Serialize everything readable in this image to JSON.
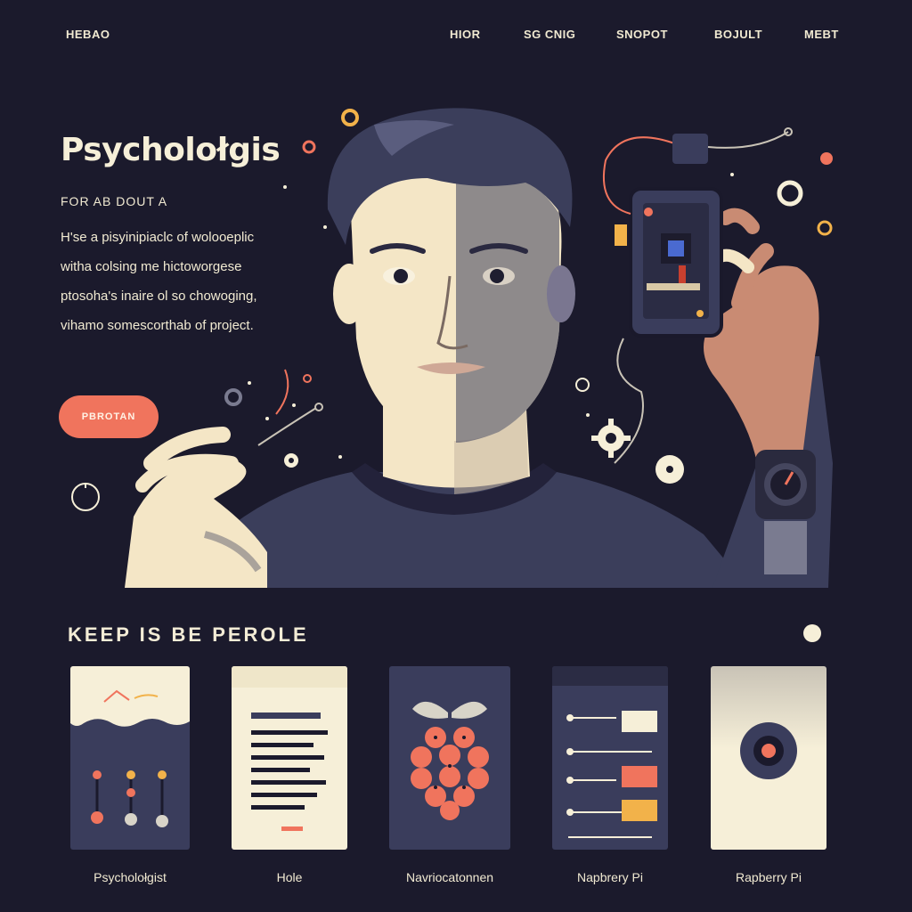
{
  "header": {
    "logo": "HEBAO",
    "nav": [
      "HIOR",
      "SG CNIG",
      "SNOPOT",
      "BOJULT",
      "MEBT"
    ]
  },
  "hero": {
    "title": "Psycholołgis",
    "kicker": "FOR AB DOUT A",
    "description": [
      "H'se a pisyinipiaclc of wolooeplic",
      "witha colsing me hictoworgese",
      "ptosoha's inaire ol so chowoging,",
      "vihamo somescorthab of project."
    ],
    "cta": "PBROTAN"
  },
  "section": {
    "title": "KEEP IS BE PEROLE"
  },
  "cards": [
    {
      "label": "Psycholołgist"
    },
    {
      "label": "Hole"
    },
    {
      "label": "Navriocatonnen"
    },
    {
      "label": "Napbrery Pi"
    },
    {
      "label": "Rapberry Pi"
    }
  ],
  "colors": {
    "background": "#1b1a2c",
    "cream": "#f6efd8",
    "accent": "#f0745d",
    "navy": "#3a3d5c",
    "amber": "#f2b24a"
  }
}
